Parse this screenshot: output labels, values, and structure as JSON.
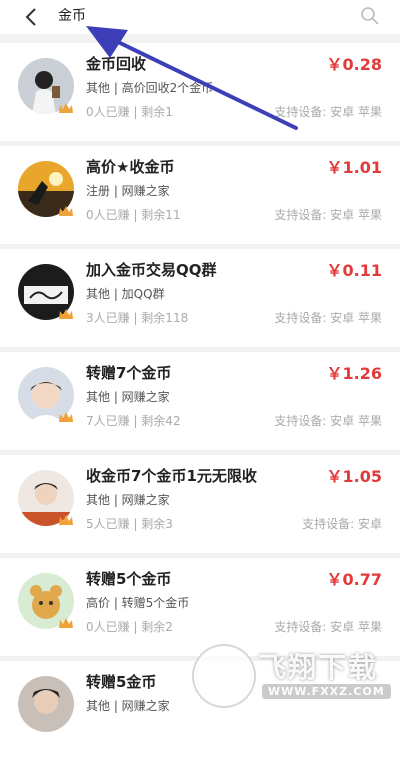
{
  "header": {
    "query": "金币",
    "back_icon": "back-chevron-icon",
    "search_icon": "search-icon"
  },
  "colors": {
    "price": "#e23a3a",
    "arrow": "#3d3fb8",
    "crown": "#f0a23a"
  },
  "tasks": [
    {
      "title": "金币回收",
      "sub": "其他 | 高价回收2个金币",
      "meta": "0人已赚 | 剩余1",
      "price": "￥0.28",
      "devices": "支持设备: 安卓 苹果"
    },
    {
      "title": "高价★收金币",
      "sub": "注册 | 网赚之家",
      "meta": "0人已赚 | 剩余11",
      "price": "￥1.01",
      "devices": "支持设备: 安卓 苹果"
    },
    {
      "title": "加入金币交易QQ群",
      "sub": "其他 | 加QQ群",
      "meta": "3人已赚 | 剩余118",
      "price": "￥0.11",
      "devices": "支持设备: 安卓 苹果"
    },
    {
      "title": "转赠7个金币",
      "sub": "其他 | 网赚之家",
      "meta": "7人已赚 | 剩余42",
      "price": "￥1.26",
      "devices": "支持设备: 安卓 苹果"
    },
    {
      "title": "收金币7个金币1元无限收",
      "sub": "其他 | 网赚之家",
      "meta": "5人已赚 | 剩余3",
      "price": "￥1.05",
      "devices": "支持设备: 安卓"
    },
    {
      "title": "转赠5个金币",
      "sub": "高价 | 转赠5个金币",
      "meta": "0人已赚 | 剩余2",
      "price": "￥0.77",
      "devices": "支持设备: 安卓 苹果"
    },
    {
      "title": "转赠5金币",
      "sub": "其他 | 网赚之家",
      "meta": "",
      "price": "",
      "devices": ""
    }
  ],
  "watermark": {
    "brand": "飞翔下载",
    "url": "WWW.FXXZ.COM"
  }
}
